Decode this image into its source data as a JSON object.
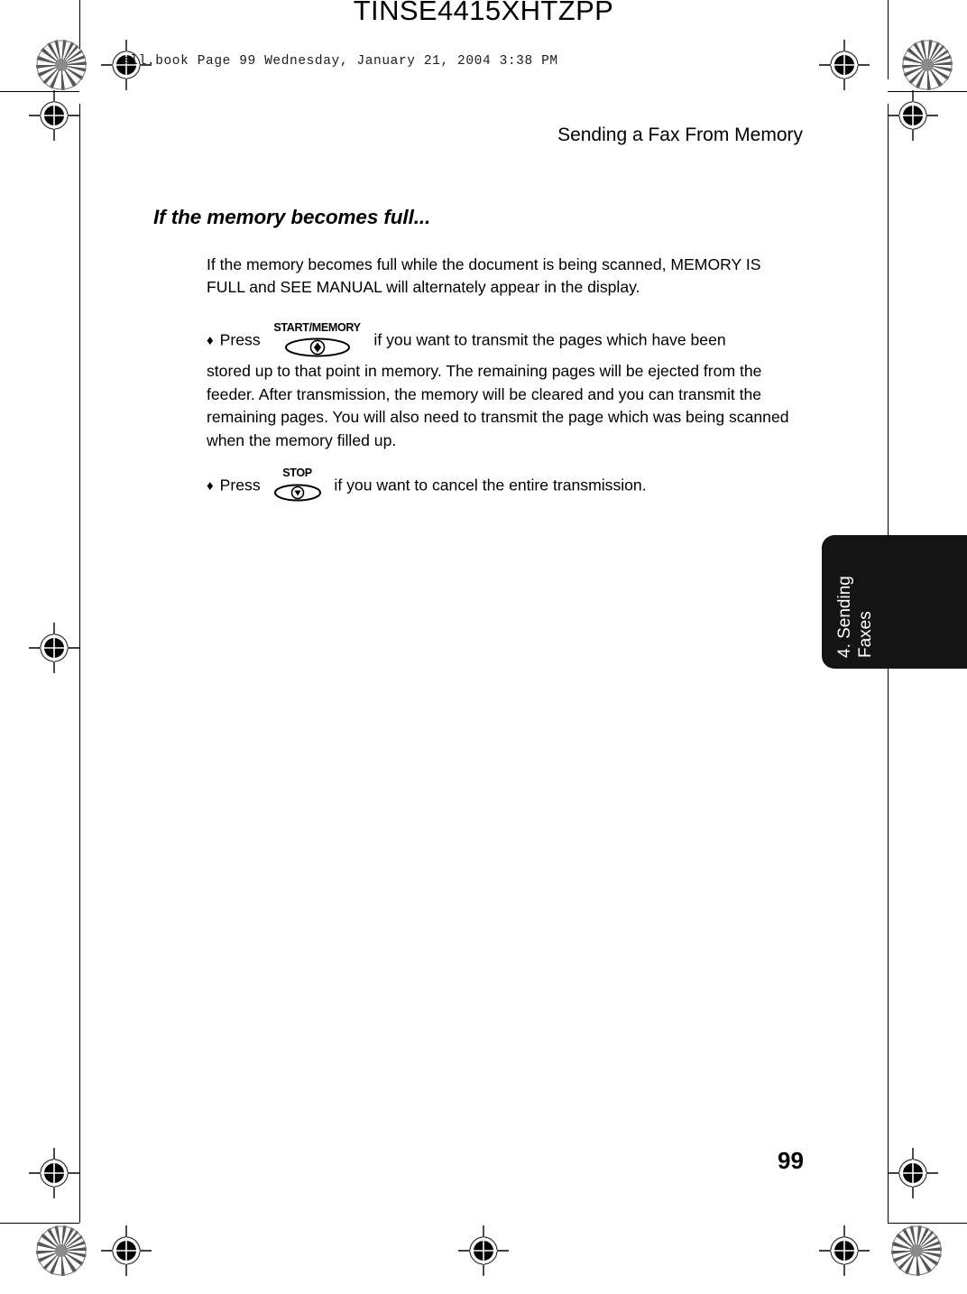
{
  "document": {
    "code": "TINSE4415XHTZPP",
    "file_stamp": "all.book  Page 99  Wednesday, January 21, 2004  3:38 PM",
    "running_head": "Sending a Fax From Memory",
    "page_number": "99"
  },
  "section": {
    "heading": "If the memory becomes full...",
    "intro": "If the memory becomes full while the document is being scanned, MEMORY IS FULL and SEE MANUAL will alternately appear in the display."
  },
  "bullets": [
    {
      "mark": "♦",
      "press_label": "Press",
      "key_label": "START/MEMORY",
      "key_icon": "start-key-icon",
      "text_after_key": "if you want to transmit the pages which have been",
      "body": "stored up to that point in memory. The remaining pages will be ejected from the feeder. After transmission, the memory will be cleared and you can transmit the remaining pages. You will also need to transmit the page which was being scanned when the memory filled up."
    },
    {
      "mark": "♦",
      "press_label": "Press",
      "key_label": "STOP",
      "key_icon": "stop-key-icon",
      "text_after_key": "if you want to cancel the entire transmission.",
      "body": ""
    }
  ],
  "chapter_tab": {
    "label": "4. Sending\nFaxes",
    "background": "#141414",
    "text_color": "#ffffff"
  },
  "marks": {
    "registration_icon": "registration-target-icon",
    "starburst_icon": "starburst-resolution-target-icon"
  }
}
